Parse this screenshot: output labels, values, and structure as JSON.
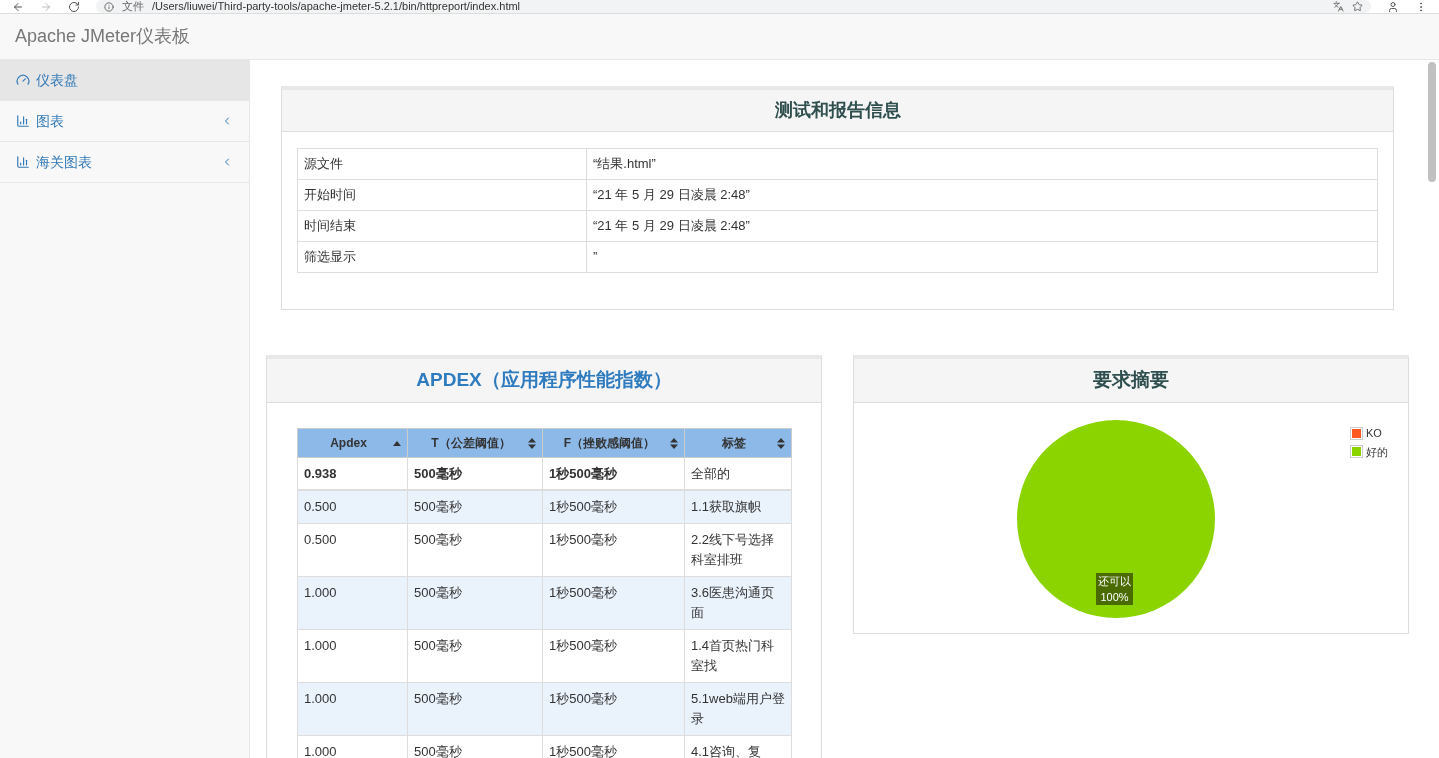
{
  "browser": {
    "scheme_label": "文件",
    "url": "/Users/liuwei/Third-party-tools/apache-jmeter-5.2.1/bin/httpreport/index.html"
  },
  "header": {
    "title": "Apache JMeter仪表板"
  },
  "sidebar": {
    "items": [
      {
        "label": "仪表盘",
        "kind": "dashboard",
        "selected": true,
        "expandable": false
      },
      {
        "label": "图表",
        "kind": "chart",
        "selected": false,
        "expandable": true
      },
      {
        "label": "海关图表",
        "kind": "chart",
        "selected": false,
        "expandable": true
      }
    ]
  },
  "info_panel": {
    "title": "测试和报告信息",
    "rows": [
      {
        "key": "源文件",
        "value": "“结果.html”"
      },
      {
        "key": "开始时间",
        "value": "“21 年 5 月 29 日凌晨 2:48”"
      },
      {
        "key": "时间结束",
        "value": "“21 年 5 月 29 日凌晨 2:48”"
      },
      {
        "key": "筛选显示",
        "value": "”"
      }
    ]
  },
  "apdex_panel": {
    "title": "APDEX（应用程序性能指数）",
    "columns": [
      {
        "label": "Apdex",
        "sorted_ascending": true
      },
      {
        "label": "T（公差阈值）",
        "sorted_ascending": false
      },
      {
        "label": "F（挫败感阈值）",
        "sorted_ascending": false
      },
      {
        "label": "标签",
        "sorted_ascending": false
      }
    ],
    "summary_row": [
      "0.938",
      "500毫秒",
      "1秒500毫秒",
      "全部的"
    ],
    "rows": [
      [
        "0.500",
        "500毫秒",
        "1秒500毫秒",
        "1.1获取旗帜"
      ],
      [
        "0.500",
        "500毫秒",
        "1秒500毫秒",
        "2.2线下号选择科室排班"
      ],
      [
        "1.000",
        "500毫秒",
        "1秒500毫秒",
        "3.6医患沟通页面"
      ],
      [
        "1.000",
        "500毫秒",
        "1秒500毫秒",
        "1.4首页热门科室找"
      ],
      [
        "1.000",
        "500毫秒",
        "1秒500毫秒",
        "5.1web端用户登录"
      ],
      [
        "1.000",
        "500毫秒",
        "1秒500毫秒",
        "4.1咨询、复"
      ]
    ]
  },
  "summary_panel": {
    "title": "要求摘要",
    "chart_data": {
      "type": "pie",
      "categories": [
        "KO",
        "好的"
      ],
      "values": [
        0,
        100
      ],
      "colors": [
        "#ff5722",
        "#8bd400"
      ]
    },
    "slice_label": {
      "name": "还可以",
      "value": "100%"
    }
  }
}
